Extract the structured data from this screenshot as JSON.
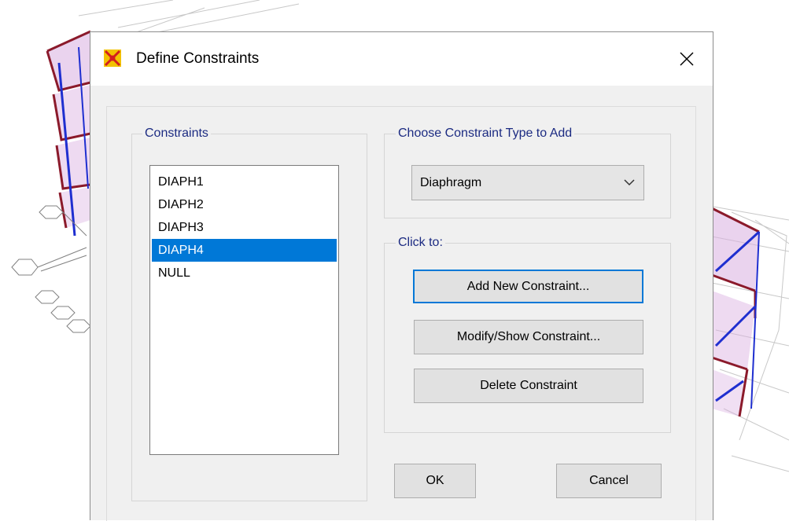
{
  "dialog": {
    "title": "Define Constraints",
    "close_icon": "close-x-icon",
    "app_icon": "sap2000-logo-icon"
  },
  "constraints_group": {
    "label": "Constraints",
    "items": [
      {
        "label": "DIAPH1",
        "selected": false
      },
      {
        "label": "DIAPH2",
        "selected": false
      },
      {
        "label": "DIAPH3",
        "selected": false
      },
      {
        "label": "DIAPH4",
        "selected": true
      },
      {
        "label": "NULL",
        "selected": false
      }
    ]
  },
  "type_group": {
    "label": "Choose Constraint Type to Add",
    "selected_type": "Diaphragm"
  },
  "click_group": {
    "label": "Click to:",
    "add_label": "Add New Constraint...",
    "modify_label": "Modify/Show Constraint...",
    "delete_label": "Delete Constraint"
  },
  "footer": {
    "ok_label": "OK",
    "cancel_label": "Cancel"
  },
  "colors": {
    "accent": "#0078d7",
    "group_label": "#1c2b82",
    "model_frame_red": "#8b1a2b",
    "model_frame_blue": "#1f2fd0",
    "model_fill": "#d9aee0"
  }
}
